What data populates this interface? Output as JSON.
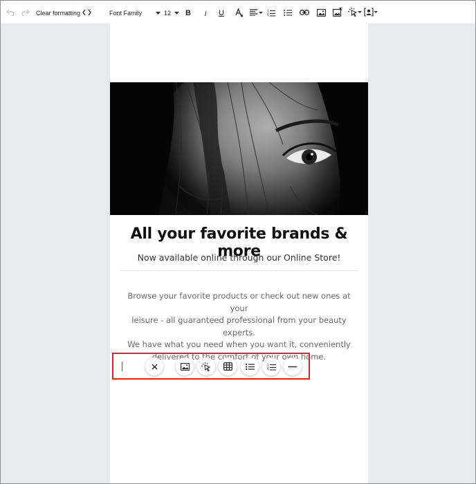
{
  "toolbar": {
    "undo_icon": "undo-icon",
    "redo_icon": "redo-icon",
    "clear_formatting_label": "Clear formatting",
    "code_view_icon": "code-icon",
    "font_family_label": "Font Family",
    "font_size_value": "12",
    "buttons": [
      "bold-icon",
      "italic-icon",
      "underline-icon",
      "text-color-icon",
      "align-icon",
      "numbered-list-icon",
      "bullet-list-icon",
      "link-icon",
      "image-icon",
      "image-edit-icon",
      "cursor-click-icon",
      "person-placeholder-icon"
    ]
  },
  "content": {
    "headline": "All your favorite brands & more",
    "subline": "Now available online through our Online Store!",
    "body_lines": [
      "Browse your favorite products or check out new ones at your",
      "leisure - all guaranteed professional from your beauty experts.",
      "We have what you need when you want it, conveniently",
      "delivered to the comfort of your own home."
    ]
  },
  "block_toolbar": {
    "buttons": [
      "close-icon",
      "image-icon",
      "cursor-click-icon",
      "table-icon",
      "bullet-list-icon",
      "numbered-list-icon",
      "horizontal-rule-icon"
    ]
  },
  "colors": {
    "highlight_border": "#e02424",
    "page_background": "#e8eaef"
  }
}
